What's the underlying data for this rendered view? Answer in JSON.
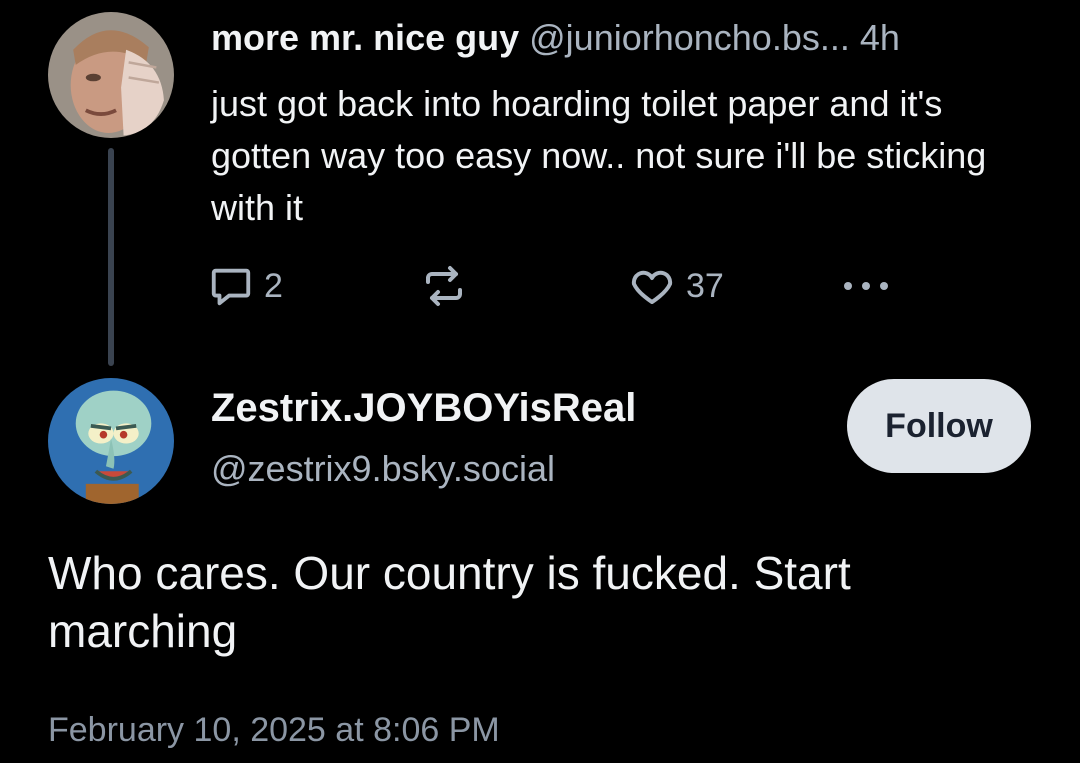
{
  "parent_post": {
    "display_name": "more mr. nice guy",
    "handle": "@juniorhoncho.bs...",
    "time_ago": "4h",
    "text": "just got back into hoarding toilet paper and it's gotten way too easy now.. not sure i'll be sticking with it",
    "reply_count": "2",
    "like_count": "37",
    "avatar_icon": "face-palm-person-avatar"
  },
  "main_post": {
    "display_name": "Zestrix.JOYBOYisReal",
    "handle": "@zestrix9.bsky.social",
    "follow_label": "Follow",
    "text": "Who cares. Our country is fucked. Start marching",
    "timestamp": "February 10, 2025 at 8:06 PM",
    "avatar_icon": "squidward-avatar"
  },
  "icons": {
    "reply": "speech-bubble-icon",
    "repost": "repost-arrows-icon",
    "like": "heart-icon",
    "more": "ellipsis-icon"
  },
  "colors": {
    "background": "#000000",
    "primary_text": "#f1f3f5",
    "secondary_text": "#aab4c0",
    "follow_bg": "#dfe4ea"
  }
}
